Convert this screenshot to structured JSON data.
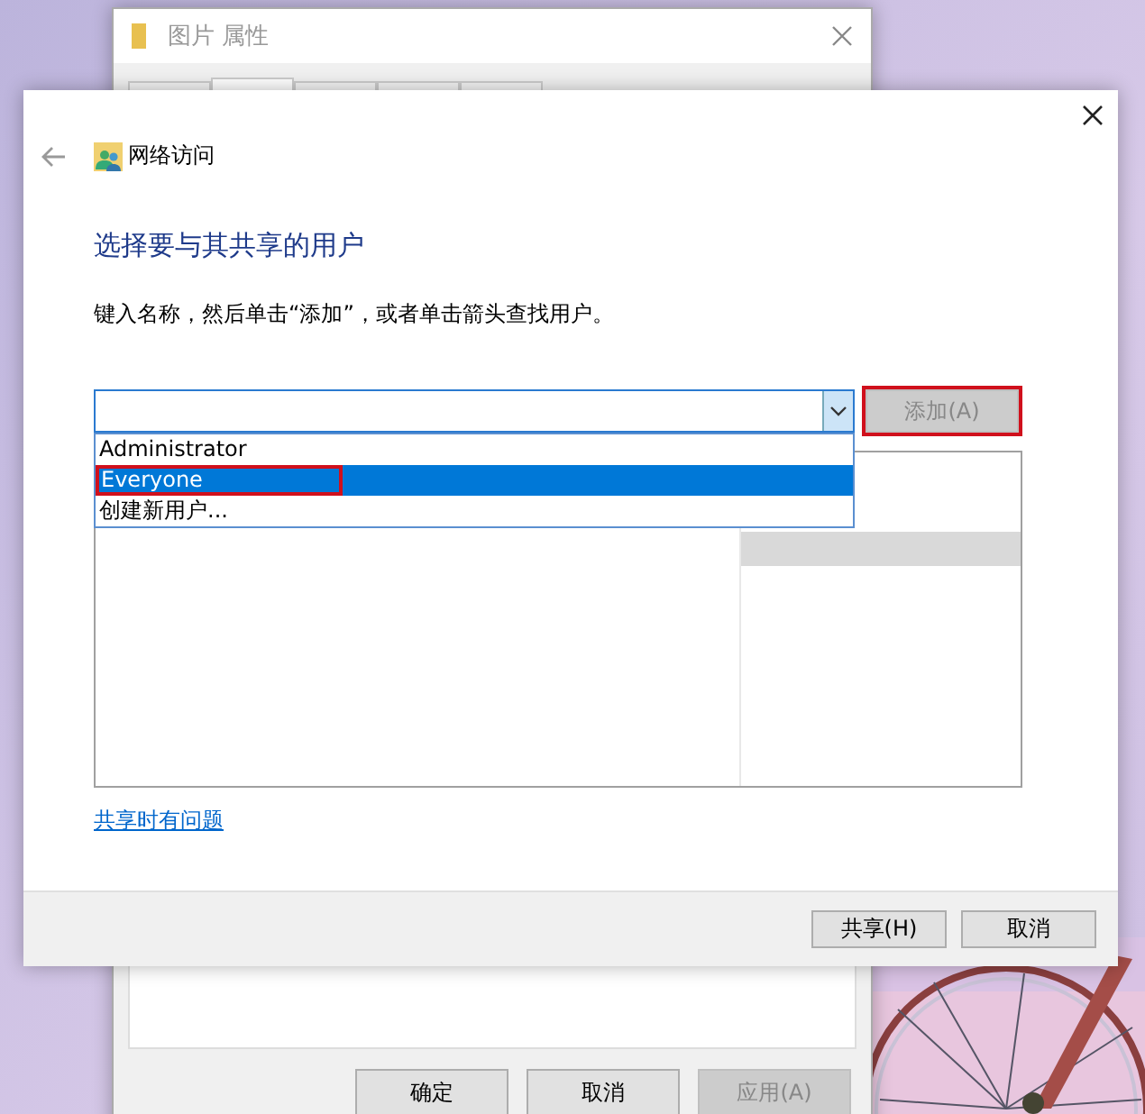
{
  "background_window": {
    "title": "图片 属性",
    "tabs": [
      {
        "selected": false
      },
      {
        "selected": true
      },
      {
        "selected": false
      },
      {
        "selected": false
      },
      {
        "selected": false
      }
    ],
    "buttons": [
      {
        "label": "确定",
        "disabled": false
      },
      {
        "label": "取消",
        "disabled": false
      },
      {
        "label": "应用(A)",
        "disabled": true
      }
    ]
  },
  "dialog": {
    "breadcrumb": "网络访问",
    "heading": "选择要与其共享的用户",
    "instruction": "键入名称，然后单击“添加”，或者单击箭头查找用户。",
    "combo": {
      "open": true,
      "options": [
        {
          "label": "Administrator",
          "selected": false,
          "highlighted": false
        },
        {
          "label": "Everyone",
          "selected": true,
          "highlighted": true
        },
        {
          "label": "创建新用户...",
          "selected": false,
          "highlighted": false
        }
      ]
    },
    "add_button": {
      "label": "添加(A)",
      "disabled": true,
      "highlighted": true
    },
    "user_list": {
      "rows": [
        {
          "selected": false
        },
        {
          "selected": true
        }
      ]
    },
    "help_link": "共享时有问题",
    "buttons": [
      {
        "label": "共享(H)",
        "disabled": false
      },
      {
        "label": "取消",
        "disabled": false
      }
    ]
  }
}
